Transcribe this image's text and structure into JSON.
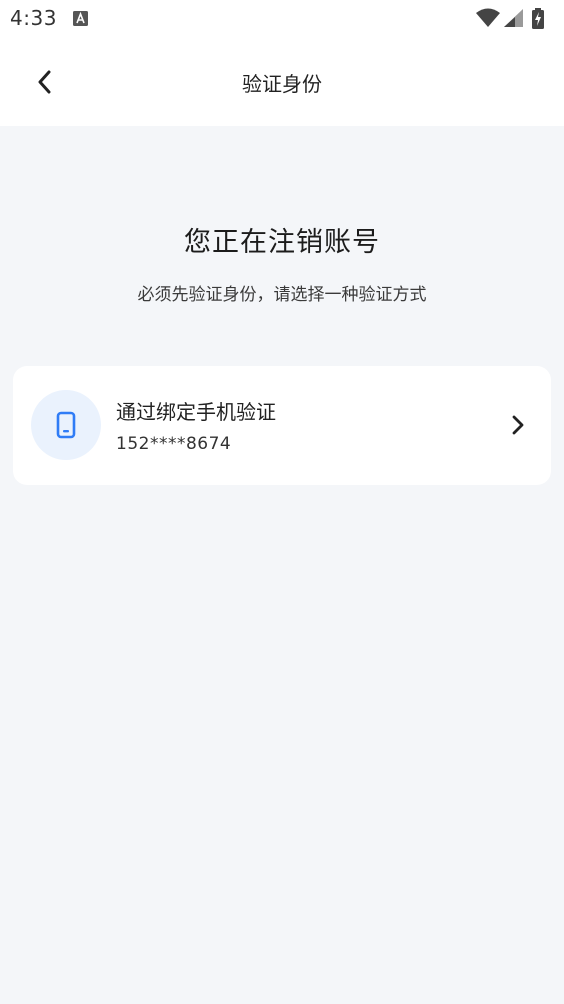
{
  "status_bar": {
    "time": "4:33",
    "icons": [
      "a-notification-icon",
      "wifi-icon",
      "signal-icon",
      "battery-charging-icon"
    ]
  },
  "header": {
    "title": "验证身份",
    "back_icon": "chevron-left-icon"
  },
  "main": {
    "title": "您正在注销账号",
    "subtitle": "必须先验证身份，请选择一种验证方式"
  },
  "options": [
    {
      "icon": "phone-icon",
      "title": "通过绑定手机验证",
      "value": "152****8674",
      "trailing_icon": "chevron-right-icon"
    }
  ],
  "colors": {
    "background": "#f4f6f9",
    "card": "#ffffff",
    "accent": "#2f7cf6",
    "icon_bg": "#eaf2fd"
  }
}
